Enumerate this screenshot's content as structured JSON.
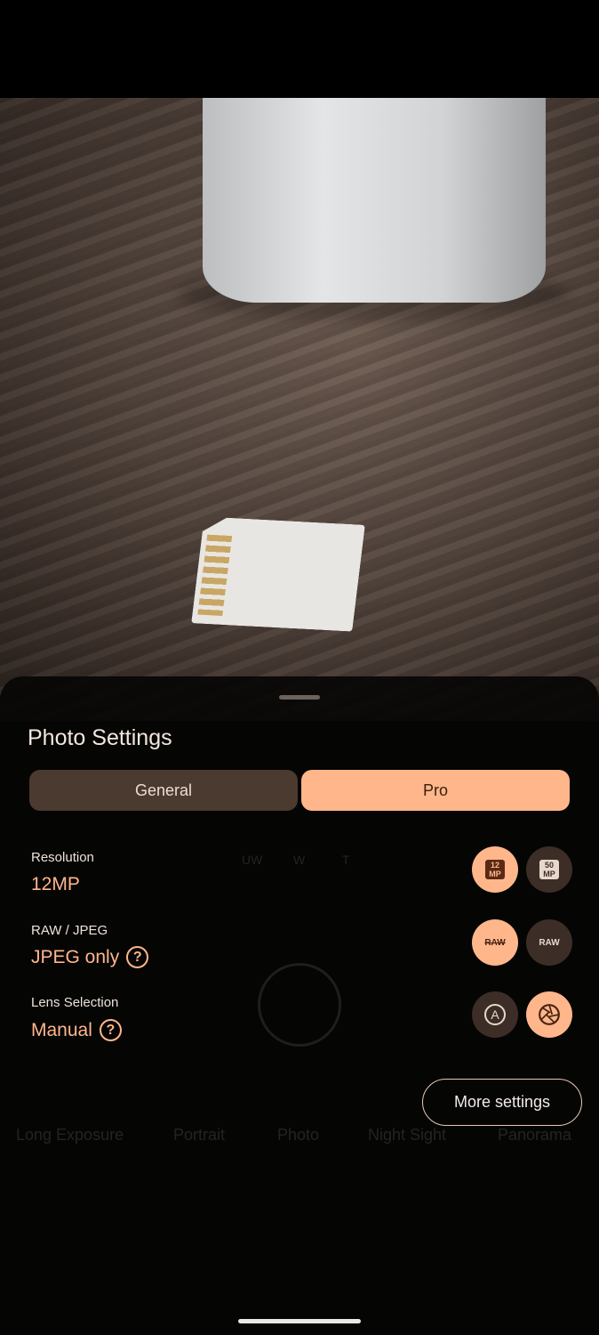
{
  "camera_background": {
    "zoom_options": [
      "UW",
      "W",
      "T"
    ],
    "modes": [
      "Long Exposure",
      "Portrait",
      "Photo",
      "Night Sight",
      "Panorama"
    ],
    "active_mode": "Photo"
  },
  "sheet": {
    "title": "Photo Settings",
    "tabs": [
      {
        "label": "General",
        "active": false
      },
      {
        "label": "Pro",
        "active": true
      }
    ],
    "settings": [
      {
        "label": "Resolution",
        "value": "12MP",
        "options": [
          {
            "label": "12 MP",
            "selected": true
          },
          {
            "label": "50 MP",
            "selected": false
          }
        ]
      },
      {
        "label": "RAW / JPEG",
        "value": "JPEG only",
        "help": "?",
        "options": [
          {
            "label": "RAW",
            "icon": "raw-off-icon",
            "selected": true
          },
          {
            "label": "RAW",
            "icon": "raw-icon",
            "selected": false
          }
        ]
      },
      {
        "label": "Lens Selection",
        "value": "Manual",
        "help": "?",
        "options": [
          {
            "label": "A",
            "icon": "auto-lens-icon",
            "selected": false
          },
          {
            "icon": "aperture-icon",
            "selected": true
          }
        ]
      }
    ],
    "more_settings": "More settings"
  },
  "colors": {
    "accent": "#ffb68b",
    "tab_inactive": "#4a3a30",
    "sheet": "#060504"
  }
}
